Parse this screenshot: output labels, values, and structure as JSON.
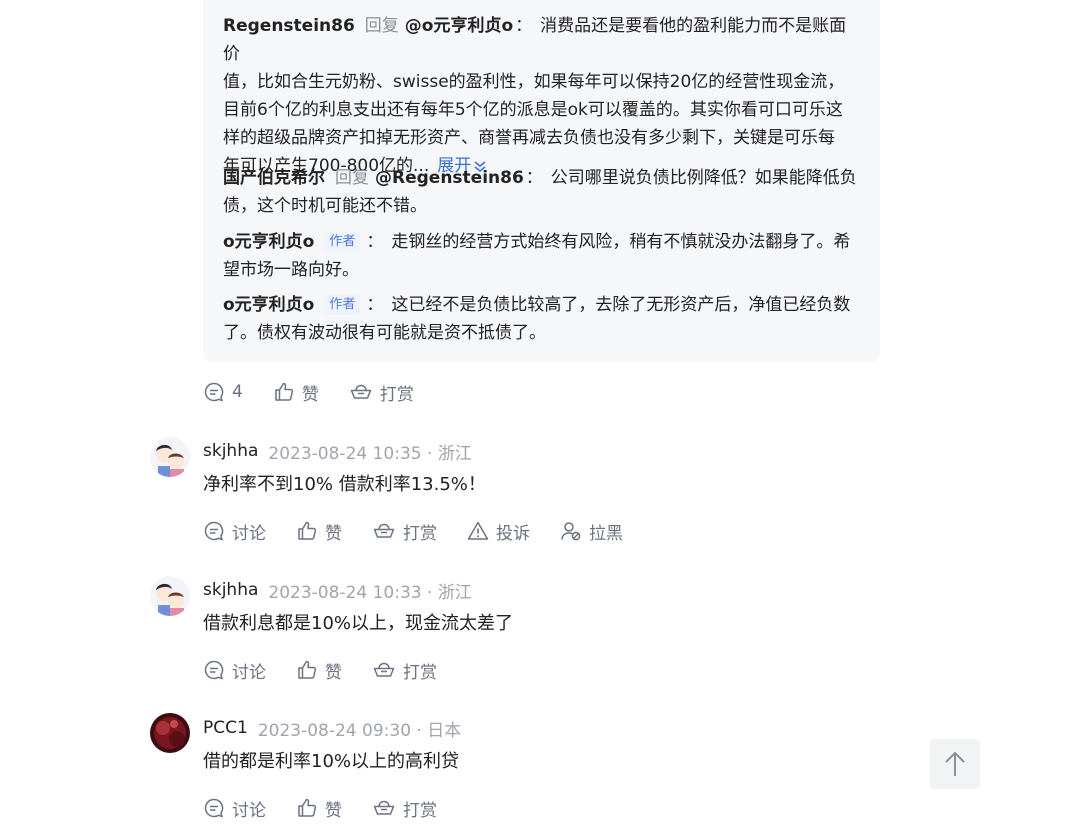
{
  "thread": {
    "replies": [
      {
        "author": "Regenstein86",
        "verb": "回复",
        "mention": "@o元亨利贞o",
        "text_lines": [
          "消费品还是要看他的盈利能力而不是账面价",
          "值，比如合生元奶粉、swisse的盈利性，如果每年可以保持20亿的经营性现金流，",
          "目前6个亿的利息支出还有每年5个亿的派息是ok可以覆盖的。其实你看可口可乐这",
          "样的超级品牌资产扣掉无形资产、商誉再减去负债也没有多少剩下，关键是可乐每",
          "年可以产生700-800亿的..."
        ],
        "expand_label": "展开"
      },
      {
        "author": "国产伯克希尔",
        "verb": "回复",
        "mention": "@Regenstein86",
        "text_lines": [
          "公司哪里说负债比例降低？如果能降低负",
          "债，这个时机可能还不错。"
        ]
      },
      {
        "author": "o元亨利贞o",
        "badge": "作者",
        "text_lines": [
          "走钢丝的经营方式始终有风险，稍有不慎就没办法翻身了。希",
          "望市场一路向好。"
        ]
      },
      {
        "author": "o元亨利贞o",
        "badge": "作者",
        "text_lines": [
          "这已经不是负债比较高了，去除了无形资产后，净值已经负数",
          "了。债权有波动很有可能就是资不抵债了。"
        ]
      }
    ],
    "actions": {
      "comment_count": "4",
      "like": "赞",
      "reward": "打赏"
    }
  },
  "comments": [
    {
      "user": "skjhha",
      "meta": "2023-08-24 10:35 · 浙江",
      "text": "净利率不到10% 借款利率13.5%！",
      "actions": {
        "discuss": "讨论",
        "like": "赞",
        "reward": "打赏",
        "report": "投诉",
        "block": "拉黑"
      }
    },
    {
      "user": "skjhha",
      "meta": "2023-08-24 10:33 · 浙江",
      "text": "借款利息都是10%以上，现金流太差了",
      "actions": {
        "discuss": "讨论",
        "like": "赞",
        "reward": "打赏"
      }
    },
    {
      "user": "PCC1",
      "meta": "2023-08-24 09:30 · 日本",
      "text": "借的都是利率10%以上的高利贷",
      "actions": {
        "discuss": "讨论",
        "like": "赞",
        "reward": "打赏"
      }
    }
  ],
  "colors": {
    "link": "#3a6fd8",
    "muted": "#a0a5ad",
    "badge_bg": "#eef3fd"
  }
}
